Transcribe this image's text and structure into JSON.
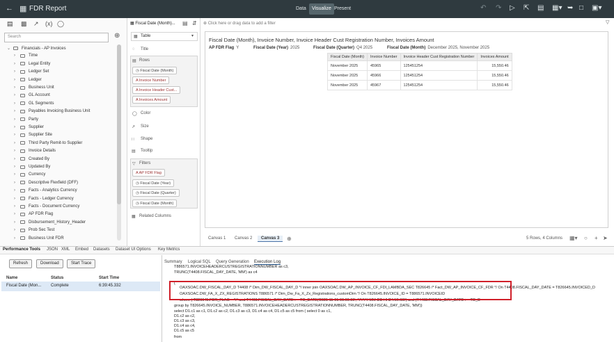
{
  "topbar": {
    "back_icon": "back-arrow-icon",
    "app_icon": "workbook-icon",
    "title": "FDR Report",
    "modes": [
      "Data",
      "Visualize",
      "Present"
    ],
    "active_mode": "Visualize"
  },
  "data_panel": {
    "search_placeholder": "Search",
    "tree": [
      {
        "label": "Financials - AP Invoices",
        "expanded": true
      },
      {
        "label": "Time"
      },
      {
        "label": "Legal Entity"
      },
      {
        "label": "Ledger Set"
      },
      {
        "label": "Ledger"
      },
      {
        "label": "Business Unit"
      },
      {
        "label": "GL Account"
      },
      {
        "label": "GL Segments"
      },
      {
        "label": "Payables Invoicing Business Unit"
      },
      {
        "label": "Party"
      },
      {
        "label": "Supplier"
      },
      {
        "label": "Supplier Site"
      },
      {
        "label": "Third Party Remit-to Supplier"
      },
      {
        "label": "Invoice Details"
      },
      {
        "label": "Created By"
      },
      {
        "label": "Updated By"
      },
      {
        "label": "Currency"
      },
      {
        "label": "Descriptive Flexfield (DFF)"
      },
      {
        "label": "Facts - Analytics Currency"
      },
      {
        "label": "Facts - Ledger Currency"
      },
      {
        "label": "Facts - Document Currency"
      },
      {
        "label": "AP FDR Flag"
      },
      {
        "label": "Disbursement_History_Header"
      },
      {
        "label": "Prob Sec Test"
      },
      {
        "label": "Business Unit FDR"
      }
    ]
  },
  "grammar_panel": {
    "viz_tab": "Fiscal Date (Month)...",
    "viz_type": "Table",
    "title_label": "Title",
    "rows_label": "Rows",
    "row_items": [
      "Fiscal Date (Month)",
      "Invoice Number",
      "Invoice Header Cust...",
      "Invoices Amount"
    ],
    "color_label": "Color",
    "size_label": "Size",
    "shape_label": "Shape",
    "tooltip_label": "Tooltip",
    "filters_label": "Filters",
    "filter_items": [
      "AP FDR Flag",
      "Fiscal Date (Year)",
      "Fiscal Date (Quarter)",
      "Fiscal Date (Month)"
    ],
    "related_label": "Related Columns"
  },
  "canvas": {
    "filter_placeholder": "Click here or drag data to add a filter",
    "viz_title": "Fiscal Date (Month), Invoice Number, Invoice Header Cust Registration Number, Invoices Amount",
    "filter_summary": [
      {
        "label": "AP FDR Flag",
        "value": "Y"
      },
      {
        "label": "Fiscal Date (Year)",
        "value": "2025"
      },
      {
        "label": "Fiscal Date (Quarter)",
        "value": "Q4 2025"
      },
      {
        "label": "Fiscal Date (Month)",
        "value": "December 2025, November 2025"
      }
    ],
    "table": {
      "headers": [
        "Fiscal Date (Month)",
        "Invoice Number",
        "Invoice Header Cust Registration Number",
        "Invoices Amount"
      ],
      "rows": [
        [
          "November 2025",
          "45965",
          "125451254",
          "15,550.46"
        ],
        [
          "November 2025",
          "45966",
          "125451254",
          "15,550.46"
        ],
        [
          "November 2025",
          "45967",
          "125451254",
          "15,550.46"
        ]
      ]
    },
    "tabs": [
      "Canvas 1",
      "Canvas 2",
      "Canvas 3"
    ],
    "active_tab": "Canvas 3",
    "rows_info": "5 Rows, 4 Columns"
  },
  "perf": {
    "tabs": [
      "Performance Tools",
      "JSON",
      "XML",
      "Embed",
      "Datasets",
      "Dataset UI Options",
      "Key Metrics"
    ],
    "buttons": {
      "refresh": "Refresh",
      "download": "Download",
      "start_trace": "Start Trace"
    },
    "columns": {
      "name": "Name",
      "status": "Status",
      "start_time": "Start Time"
    },
    "row": {
      "name": "Fiscal Date (Mon...",
      "status": "Complete",
      "start_time": "6:39:45.332"
    },
    "detail_tabs": [
      "Summary",
      "Logical SQL",
      "Query Generation",
      "Execution Log"
    ],
    "active_detail": "Execution Log",
    "sql_lines": [
      "T886571.INVOICEHEADERCUSTREGISTRATIONNUMBER as c3,",
      "TRUNC(T4408.FISCAL_DAY_DATE, 'MM') as c4",
      "(",
      "OAXSOAC.DW_FISCAL_DAY_D T4408 /* Dim_DW_FISCAL_DAY_D */  inner join OAXSOAC.DW_AP_INVOICE_CF_FDI_LAMBDA_SEC T826645 /* Fact_DW_AP_INVOICE_CF_FDR */  On T4408.FISCAL_DAY_DATE = T826645.INVOICED_D",
      "OAXSOAC.DW_FA_X_ZX_REGISTRATIONS T886571 /* Dim_Dw_Fa_X_Zx_Registrations_customDim */  On T826645.INVOICE_ID = T886571.INVOICEID",
      "where ( T826645.FDR_FLAG = 'Y' and T4408.FISCAL_DAY_DATE >= TO_DATE('2025-11-01 00:00:00', 'YYYY-MM-DD HH24:MI:SS') and (T4408.FISCAL_DAY_DATE >= TO_D",
      "group by T826645.INVOICE_NUMBER, T886571.INVOICEHEADERCUSTREGISTRATIONNUMBER, TRUNC(T4408.FISCAL_DAY_DATE, 'MM'))",
      "select D1.c1 as c1, D1.c2 as c2, D1.c3 as c3, D1.c4 as c4, D1.c5 as c5 from ( select 0 as c1,",
      "D1.c2 as c2,",
      "D1.c3 as c3,",
      "D1.c4 as c4,",
      "D1.c5 as c5",
      "from"
    ]
  }
}
